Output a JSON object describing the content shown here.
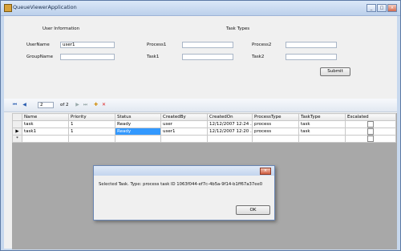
{
  "window": {
    "title": "QueueViewerApplication"
  },
  "form": {
    "user_info_heading": "User Information",
    "task_types_heading": "Task Types",
    "username_label": "UserName",
    "username_value": "user1",
    "groupname_label": "GroupName",
    "groupname_value": "",
    "process1_label": "Process1",
    "task1_label": "Task1",
    "process2_label": "Process2",
    "task2_label": "Task2",
    "submit_label": "Submit"
  },
  "navigator": {
    "position": "2",
    "of_text": "of 2"
  },
  "grid": {
    "columns": [
      "Name",
      "Priority",
      "Status",
      "CreatedBy",
      "CreatedOn",
      "ProcessType",
      "TaskType",
      "Escalated"
    ],
    "rows": [
      {
        "indicator": "",
        "Name": "task",
        "Priority": "1",
        "Status": "Ready",
        "CreatedBy": "user",
        "CreatedOn": "12/12/2007 12:24 ...",
        "ProcessType": "process",
        "TaskType": "task"
      },
      {
        "indicator": "▶",
        "Name": "task1",
        "Priority": "1",
        "Status": "Ready",
        "CreatedBy": "user1",
        "CreatedOn": "12/12/2007 12:20 ...",
        "ProcessType": "process",
        "TaskType": "task"
      },
      {
        "indicator": "*",
        "Name": "",
        "Priority": "",
        "Status": "",
        "CreatedBy": "",
        "CreatedOn": "",
        "ProcessType": "",
        "TaskType": ""
      }
    ]
  },
  "dialog": {
    "message": "Selected Task. Type: process task ID 1063f044-ef7c-4b5a-9f14-b1ff67a37ee0",
    "ok_label": "OK"
  }
}
